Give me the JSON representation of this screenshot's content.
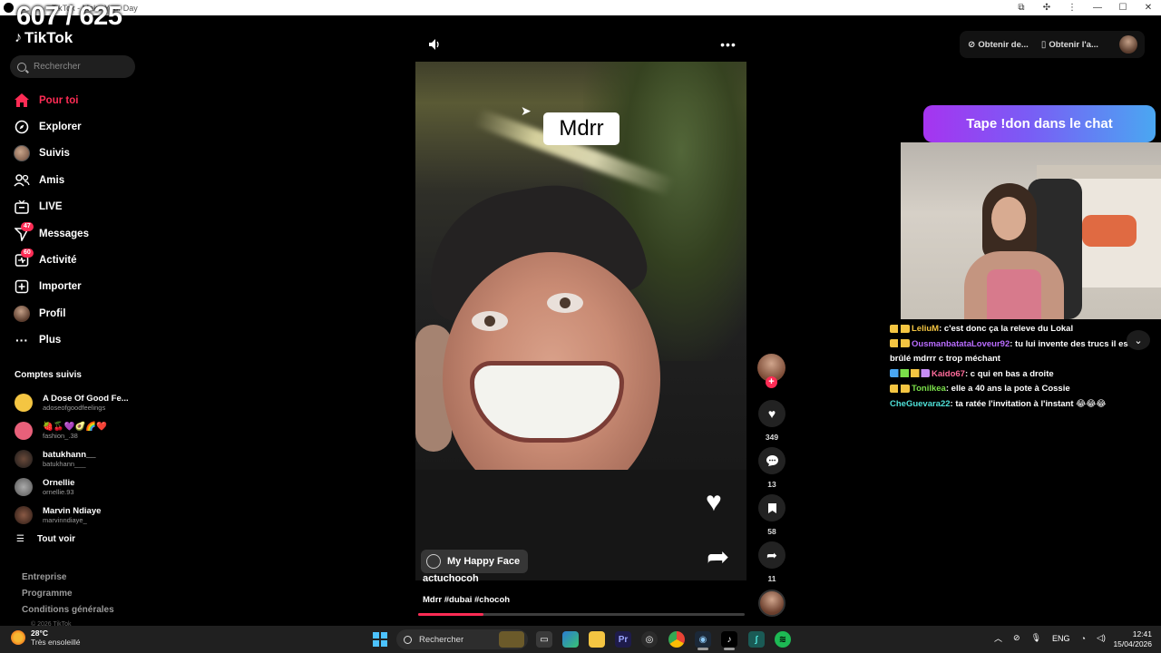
{
  "browser": {
    "title": "TikTok - Make Your Day",
    "controls": [
      "—",
      "☐",
      "✕"
    ]
  },
  "overlay": {
    "counter": "607 / 625",
    "donation_banner": "Tape !don dans le chat"
  },
  "sidebar": {
    "logo_text": "TikTok",
    "search_placeholder": "Rechercher",
    "nav": [
      {
        "label": "Pour toi",
        "icon": "home-icon",
        "active": true
      },
      {
        "label": "Explorer",
        "icon": "compass-icon"
      },
      {
        "label": "Suivis",
        "icon": "following-avatar-icon"
      },
      {
        "label": "Amis",
        "icon": "friends-icon"
      },
      {
        "label": "LIVE",
        "icon": "live-icon"
      },
      {
        "label": "Messages",
        "icon": "messages-icon",
        "badge": "47"
      },
      {
        "label": "Activité",
        "icon": "activity-icon",
        "badge": "60"
      },
      {
        "label": "Importer",
        "icon": "upload-icon"
      },
      {
        "label": "Profil",
        "icon": "profile-avatar-icon"
      },
      {
        "label": "Plus",
        "icon": "more-icon"
      }
    ],
    "followed_title": "Comptes suivis",
    "followed": [
      {
        "name": "A Dose Of Good Fe...",
        "handle": "adoseofgoodfeelings",
        "color": "#f4c542"
      },
      {
        "name": "🍓🍒💜🥑🌈❤️",
        "handle": "fashion_.38",
        "color": "#e8607a"
      },
      {
        "name": "batukhann__",
        "handle": "batukhann___",
        "color": "#3a2a22"
      },
      {
        "name": "Ornellie",
        "handle": "ornellie.93",
        "color": "#777777"
      },
      {
        "name": "Marvin Ndiaye",
        "handle": "marvinndiaye_",
        "color": "#5a3a30"
      }
    ],
    "see_all": "Tout voir",
    "footer": [
      "Entreprise",
      "Programme",
      "Conditions générales"
    ],
    "copyright": "© 2026 TikTok"
  },
  "video": {
    "caption_sticker": "Mdrr",
    "effect": "My Happy Face",
    "author": "actuchocoh",
    "description": "Mdrr #dubai #chocoh",
    "progress": 0.2
  },
  "actions": {
    "likes": "349",
    "comments": "13",
    "saves": "58",
    "shares": "11"
  },
  "top_right": {
    "item1": "Obtenir de...",
    "item2": "Obtenir l'a..."
  },
  "chat": [
    {
      "user": "LeliuM",
      "color": "#f4c542",
      "msg": "c'est donc ça la releve du Lokal"
    },
    {
      "user": "OusmanbatataLoveur92",
      "color": "#b96cff",
      "msg": "tu lui invente des trucs il est pas brûlé mdrrr c trop méchant"
    },
    {
      "user": "Kaido67",
      "color": "#ff6b9a",
      "msg": "c qui en bas a droite"
    },
    {
      "user": "Tonilkea",
      "color": "#7be04a",
      "msg": "elle a 40 ans la pote à Cossie"
    },
    {
      "user": "CheGuevara22",
      "color": "#4fe0d8",
      "msg": "ta ratée l'invitation à l'instant 😂😂😂"
    }
  ],
  "taskbar": {
    "temperature": "28°C",
    "condition": "Très ensoleillé",
    "search_label": "Rechercher",
    "language": "ENG",
    "time": "12:41",
    "date": "15/04/2026"
  }
}
